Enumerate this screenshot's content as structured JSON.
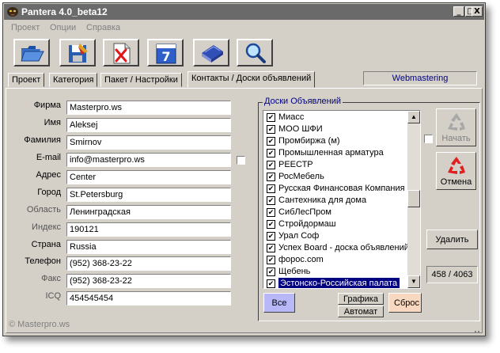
{
  "window": {
    "title": "Pantera 4.0_beta12",
    "btn_min": "_",
    "btn_max": "□",
    "btn_close": "X"
  },
  "menu": [
    "Проект",
    "Опции",
    "Справка"
  ],
  "toolbar_icons": [
    "open-folder-icon",
    "save-disk-icon",
    "delete-document-icon",
    "calendar-icon",
    "book-icon",
    "search-magnifier-icon"
  ],
  "tabs": [
    "Проект",
    "Категория",
    "Пакет / Настройки",
    "Контакты / Доски объявлений"
  ],
  "active_tab": 3,
  "webmastering_label": "Webmastering",
  "contact": {
    "firm": {
      "label": "Фирма",
      "value": "Masterpro.ws"
    },
    "name": {
      "label": "Имя",
      "value": "Aleksej"
    },
    "surname": {
      "label": "Фамилия",
      "value": "Smirnov"
    },
    "email": {
      "label": "E-mail",
      "value": "info@masterpro.ws"
    },
    "address": {
      "label": "Адрес",
      "value": "Center"
    },
    "city": {
      "label": "Город",
      "value": "St.Petersburg"
    },
    "region": {
      "label": "Область",
      "value": "Ленинградская"
    },
    "zip": {
      "label": "Индекс",
      "value": "190121"
    },
    "country": {
      "label": "Страна",
      "value": "Russia"
    },
    "phone": {
      "label": "Телефон",
      "value": "(952) 368-23-22"
    },
    "fax": {
      "label": "Факс",
      "value": "(952) 368-23-22"
    },
    "icq": {
      "label": "ICQ",
      "value": "454545454"
    }
  },
  "boards": {
    "title": "Доски Объявлений",
    "items": [
      "Миасс",
      "МОО ШФИ",
      "Промбиржа (м)",
      "Промышленная арматура",
      "РЕЕСТР",
      "РосМебель",
      "Русская Финансовая Компания",
      "Сантехника для дома",
      "СибЛесПром",
      "Стройдормаш",
      "Урал Соф",
      "Успех Board - доска объявлений",
      "форос.com",
      "Щебень",
      "Эстонско-Российская палата"
    ],
    "selected_index": 14,
    "all_label": "Все",
    "graphics_label": "Графика",
    "auto_label": "Автомат",
    "reset_label": "Сброс",
    "start_label": "Начать",
    "cancel_label": "Отмена",
    "delete_label": "Удалить",
    "counter": "458 / 4063"
  },
  "footer": "© Masterpro.ws"
}
